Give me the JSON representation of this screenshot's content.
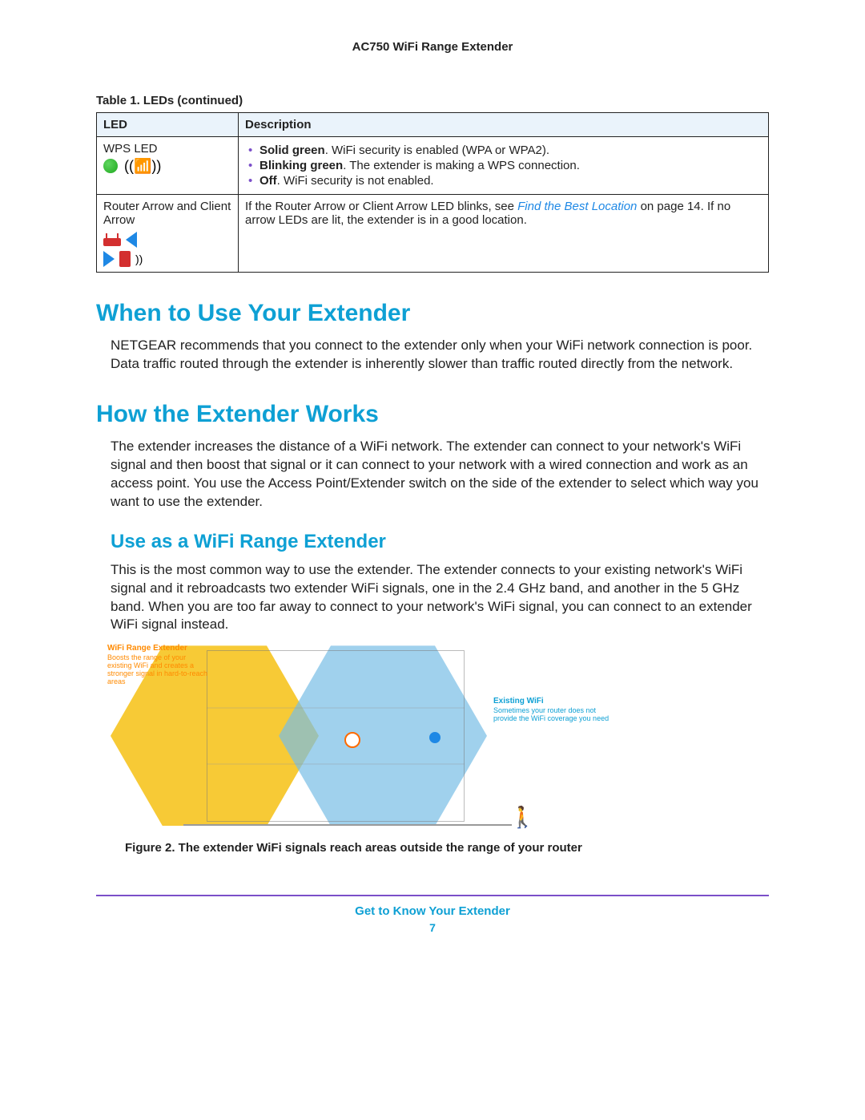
{
  "header": {
    "title": "AC750 WiFi Range Extender"
  },
  "table": {
    "caption": "Table 1.  LEDs  (continued)",
    "headers": {
      "col1": "LED",
      "col2": "Description"
    },
    "rows": [
      {
        "led_name": "WPS LED",
        "bullets": [
          {
            "bold": "Solid green",
            "rest": ". WiFi security is enabled (WPA or WPA2)."
          },
          {
            "bold": "Blinking green",
            "rest": ". The extender is making a WPS connection."
          },
          {
            "bold": "Off",
            "rest": ". WiFi security is not enabled."
          }
        ]
      },
      {
        "led_name": "Router Arrow and Client Arrow",
        "desc_pre": "If the Router Arrow or Client Arrow LED blinks, see ",
        "link_italic": "Find the Best Location",
        "desc_mid": " on page 14. If no arrow LEDs are lit, the extender is in a good location."
      }
    ]
  },
  "sections": {
    "when": {
      "title": "When to Use Your Extender",
      "body": "NETGEAR recommends that you connect to the extender only when your WiFi network connection is poor. Data traffic routed through the extender is inherently slower than traffic routed directly from the network."
    },
    "how": {
      "title": "How the Extender Works",
      "body": "The extender increases the distance of a WiFi network. The extender can connect to your network's WiFi signal and then boost that signal or it can connect to your network with a wired connection and work as an access point. You use the Access Point/Extender switch on the side of the extender to select which way you want to use the extender."
    },
    "use_as": {
      "title": "Use as a WiFi Range Extender",
      "body": "This is the most common way to use the extender. The extender connects to your existing network's WiFi signal and it rebroadcasts two extender WiFi signals, one in the 2.4 GHz band, and another in the 5 GHz band. When you are too far away to connect to your network's WiFi signal, you can connect to an extender WiFi signal instead."
    }
  },
  "figure": {
    "left_label_title": "WiFi Range Extender",
    "left_label_sub": "Boosts the range of your existing WiFi and creates a stronger signal in hard-to-reach areas",
    "right_label_title": "Existing WiFi",
    "right_label_sub": "Sometimes your router does not provide the WiFi coverage you need",
    "caption": "Figure 2. The extender WiFi signals reach areas outside the range of your router"
  },
  "footer": {
    "title": "Get to Know Your Extender",
    "page": "7"
  }
}
